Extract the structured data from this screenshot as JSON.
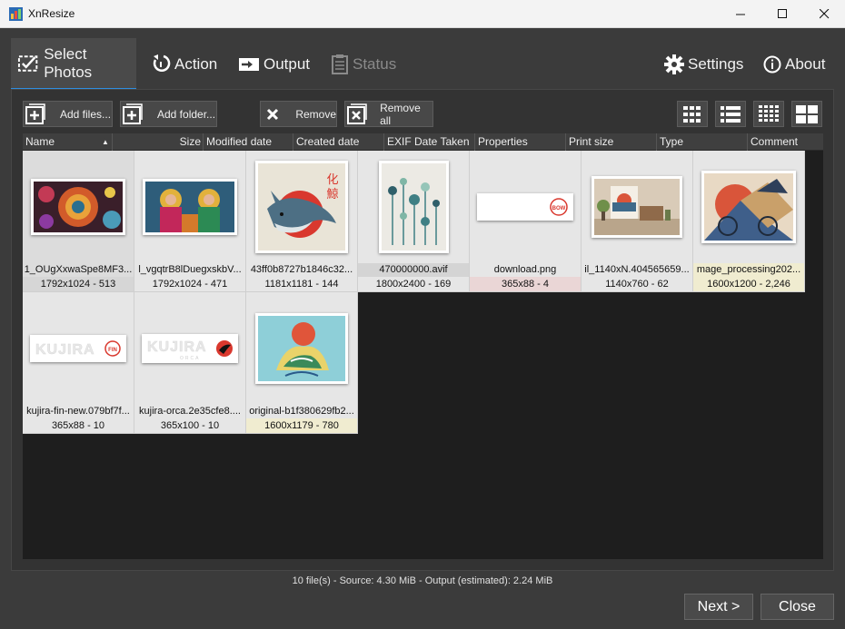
{
  "window": {
    "title": "XnResize",
    "minimize_glyph": "—",
    "maximize_glyph": "☐",
    "close_glyph": "✕"
  },
  "tabs": [
    {
      "label": "Select Photos",
      "icon": "select-photos-icon",
      "state": "active"
    },
    {
      "label": "Action",
      "icon": "action-icon",
      "state": "normal"
    },
    {
      "label": "Output",
      "icon": "output-icon",
      "state": "normal"
    },
    {
      "label": "Status",
      "icon": "status-icon",
      "state": "disabled"
    }
  ],
  "top_right": {
    "settings": "Settings",
    "about": "About"
  },
  "toolbar": {
    "add_files": "Add files...",
    "add_folder": "Add folder...",
    "remove": "Remove",
    "remove_all": "Remove all",
    "view_modes": [
      "thumbnails-view-icon",
      "list-view-icon",
      "small-thumbnails-view-icon",
      "large-thumbnails-view-icon"
    ]
  },
  "columns": {
    "name": "Name",
    "size": "Size",
    "modified": "Modified date",
    "created": "Created date",
    "exif": "EXIF Date Taken",
    "properties": "Properties",
    "print_size": "Print size",
    "type": "Type",
    "comment": "Comment"
  },
  "files": [
    {
      "name": "1_OUgXxwaSpe8MF3...",
      "info": "1792x1024 - 513"
    },
    {
      "name": "l_vgqtrB8lDuegxskbV...",
      "info": "1792x1024 - 471"
    },
    {
      "name": "43ff0b8727b1846c32...",
      "info": "1181x1181 - 144"
    },
    {
      "name": "470000000.avif",
      "info": "1800x2400 - 169"
    },
    {
      "name": "download.png",
      "info": "365x88 - 4"
    },
    {
      "name": "il_1140xN.404565659...",
      "info": "1140x760 - 62"
    },
    {
      "name": "mage_processing202...",
      "info": "1600x1200 - 2,246"
    },
    {
      "name": "kujira-fin-new.079bf7f...",
      "info": "365x88 - 10"
    },
    {
      "name": "kujira-orca.2e35cfe8....",
      "info": "365x100 - 10"
    },
    {
      "name": "original-b1f380629fb2...",
      "info": "1600x1179 - 780"
    }
  ],
  "thumb_text": {
    "whale_kanji_1": "化",
    "whale_kanji_2": "鯨",
    "bow": "BOW",
    "kujira": "KUJIRA",
    "fin": "FIN",
    "orca": "ORCA"
  },
  "status_text": "10 file(s) - Source: 4.30 MiB - Output (estimated): 2.24 MiB",
  "buttons": {
    "next": "Next >",
    "close": "Close"
  },
  "colors": {
    "accent": "#2f8ee0",
    "panel": "#333333",
    "grid": "#1e1e1e",
    "item_bg": "#e6e6e6",
    "info_highlight": "#f0ecd0",
    "kujira_red": "#d9382e"
  }
}
